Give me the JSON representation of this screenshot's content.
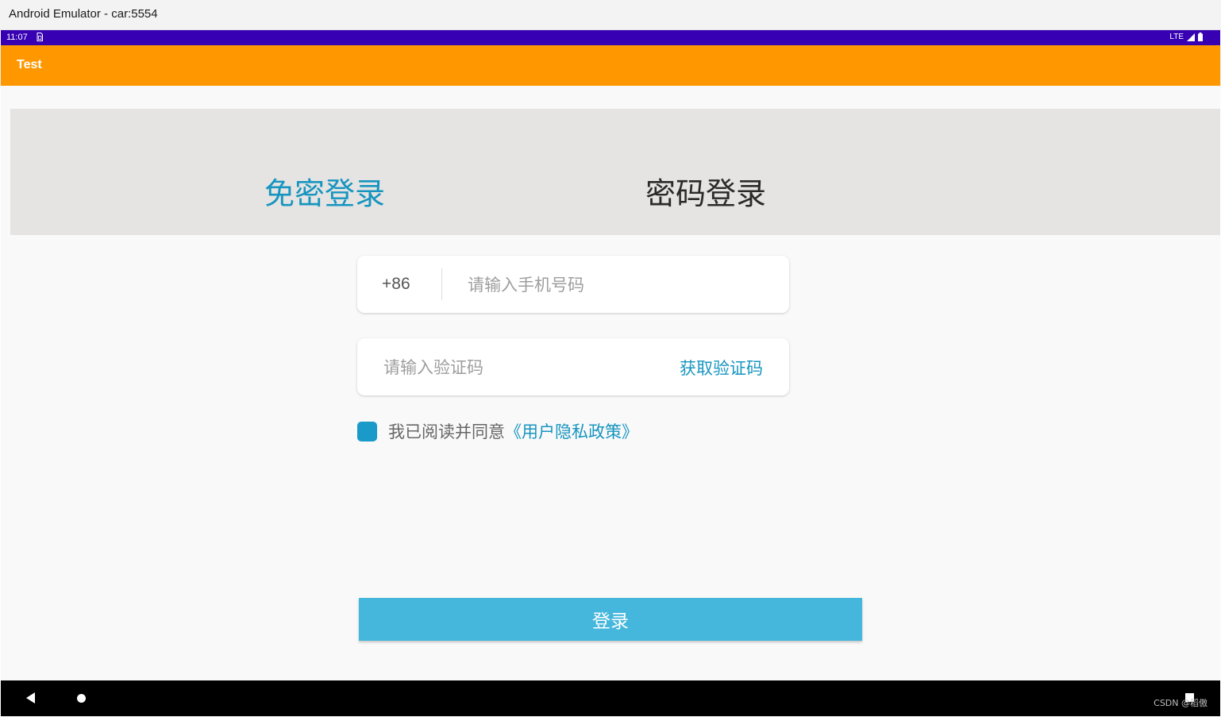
{
  "window": {
    "title": "Android Emulator - car:5554"
  },
  "status_bar": {
    "time": "11:07",
    "network": "LTE",
    "sim_icon": "sim-card-icon",
    "signal_icon": "signal-icon",
    "battery_icon": "battery-icon"
  },
  "app_bar": {
    "title": "Test",
    "color": "#ff9800"
  },
  "tabs": [
    {
      "label": "免密登录",
      "active": true,
      "color": "#1795c0"
    },
    {
      "label": "密码登录",
      "active": false,
      "color": "#2a2a2a"
    }
  ],
  "phone": {
    "country_code": "+86",
    "placeholder": "请输入手机号码",
    "value": ""
  },
  "code": {
    "placeholder": "请输入验证码",
    "value": "",
    "get_code_label": "获取验证码"
  },
  "agreement": {
    "checked": true,
    "text": "我已阅读并同意",
    "link": "《用户隐私政策》"
  },
  "login_button": {
    "label": "登录",
    "color": "#45b7dc"
  },
  "nav_bar": {
    "back_icon": "back-icon",
    "home_icon": "home-icon",
    "recents_icon": "recents-icon"
  },
  "watermark": "CSDN @稻傲"
}
